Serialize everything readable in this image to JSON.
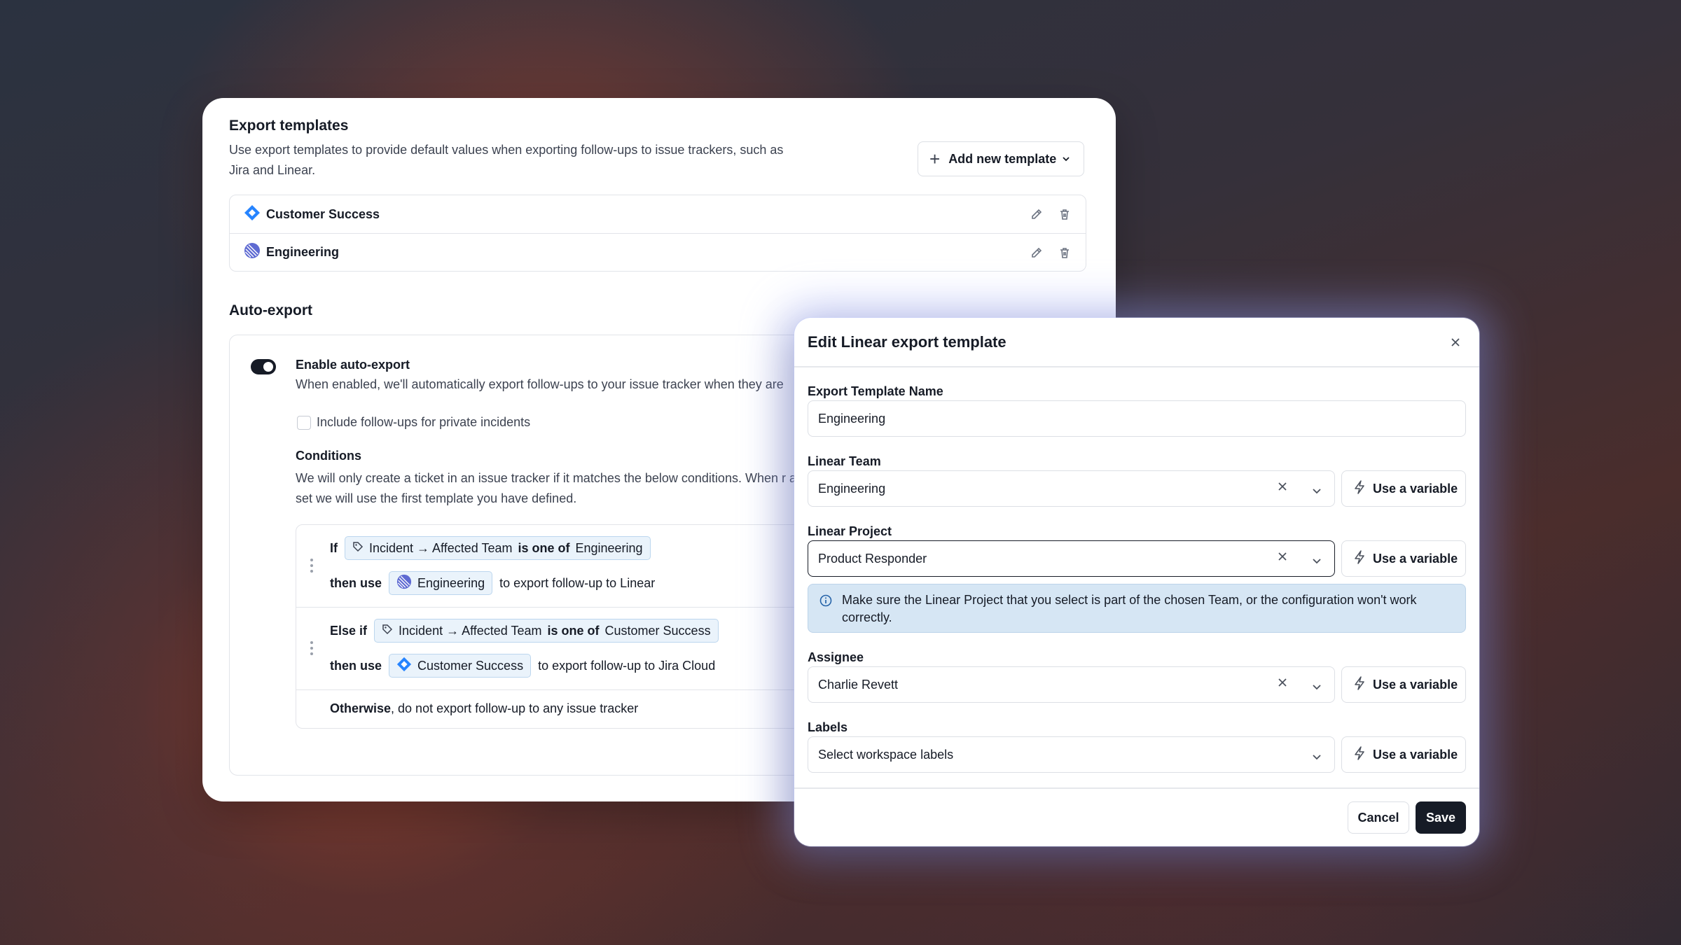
{
  "templates_section": {
    "title": "Export templates",
    "description": "Use export templates to provide default values when exporting follow-ups to issue trackers, such as Jira and Linear.",
    "add_button": "Add new template",
    "items": [
      {
        "name": "Customer Success",
        "icon": "jira-icon"
      },
      {
        "name": "Engineering",
        "icon": "linear-icon"
      }
    ]
  },
  "auto_export": {
    "title": "Auto-export",
    "toggle_enabled": true,
    "enable_label": "Enable auto-export",
    "enable_desc": "When enabled, we'll automatically export follow-ups to your issue tracker when they are",
    "private_label": "Include follow-ups for private incidents",
    "private_checked": false,
    "conditions_title": "Conditions",
    "conditions_desc": "We will only create a ticket in an issue tracker if it matches the below conditions. When r are set we will use the first template you have defined.",
    "rules": [
      {
        "keyword": "If",
        "subject": "Incident → Affected Team",
        "operator": "is one of",
        "value": "Engineering",
        "then_label": "then use",
        "template": "Engineering",
        "template_icon": "linear-icon",
        "suffix": "to export follow-up to Linear"
      },
      {
        "keyword": "Else if",
        "subject": "Incident → Affected Team",
        "operator": "is one of",
        "value": "Customer Success",
        "then_label": "then use",
        "template": "Customer Success",
        "template_icon": "jira-icon",
        "suffix": "to export follow-up to Jira Cloud"
      }
    ],
    "otherwise_keyword": "Otherwise",
    "otherwise_text": ", do not export follow-up to any issue tracker"
  },
  "modal": {
    "title": "Edit Linear export template",
    "name_label": "Export Template Name",
    "name_value": "Engineering",
    "team_label": "Linear Team",
    "team_value": "Engineering",
    "project_label": "Linear Project",
    "project_value": "Product Responder",
    "callout": "Make sure the Linear Project that you select is part of the chosen Team, or the configuration won't work correctly.",
    "assignee_label": "Assignee",
    "assignee_value": "Charlie Revett",
    "labels_label": "Labels",
    "labels_placeholder": "Select workspace labels",
    "variable_button": "Use a variable",
    "cancel": "Cancel",
    "save": "Save"
  },
  "colors": {
    "primary": "#161b26",
    "jira_blue": "#2684ff",
    "linear_purple": "#5e6ad2",
    "pill_bg": "#eaf3fb",
    "callout_bg": "#d6e6f4"
  }
}
